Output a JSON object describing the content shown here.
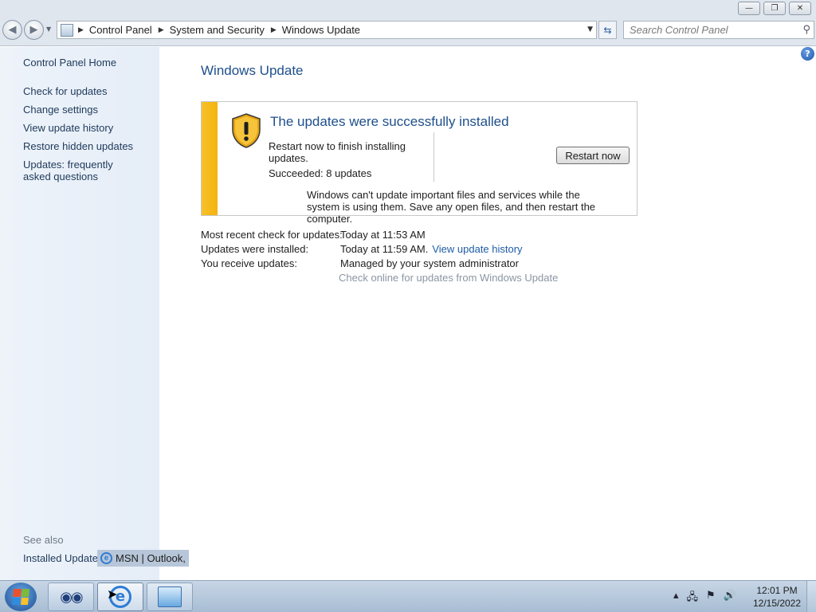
{
  "window": {
    "minimize_glyph": "—",
    "restore_glyph": "❐",
    "close_glyph": "✕"
  },
  "nav": {
    "back_glyph": "◀",
    "forward_glyph": "▶",
    "breadcrumbs": [
      "Control Panel",
      "System and Security",
      "Windows Update"
    ],
    "search_placeholder": "Search Control Panel"
  },
  "sidebar": {
    "home": "Control Panel Home",
    "links": [
      "Check for updates",
      "Change settings",
      "View update history",
      "Restore hidden updates",
      "Updates: frequently asked questions"
    ],
    "see_also": "See also",
    "installed_updates": "Installed Updates",
    "tooltip": "MSN | Outlook,"
  },
  "main": {
    "title": "Windows Update",
    "status": {
      "heading": "The updates were successfully installed",
      "message": "Restart now to finish installing updates.",
      "count": "Succeeded: 8 updates",
      "button": "Restart now",
      "note": "Windows can't update important files and services while the system is using them. Save any open files, and then restart the computer.",
      "stripe_color": "#f4b30f"
    },
    "info": [
      {
        "label": "Most recent check for updates:",
        "value": "Today at 11:53 AM",
        "link": ""
      },
      {
        "label": "Updates were installed:",
        "value": "Today at 11:59 AM.",
        "link": "View update history"
      },
      {
        "label": "You receive updates:",
        "value": "Managed by your system administrator",
        "link": ""
      }
    ],
    "check_online": "Check online for updates from Windows Update"
  },
  "taskbar": {
    "time": "12:01 PM",
    "date": "12/15/2022",
    "tray_icons": [
      "arrow-up-icon",
      "network-icon",
      "action-center-icon",
      "volume-icon"
    ]
  },
  "colors": {
    "accent_blue": "#1e4f8c",
    "link_blue": "#1e5ca8",
    "sidebar_bg": "#e5edf7"
  }
}
